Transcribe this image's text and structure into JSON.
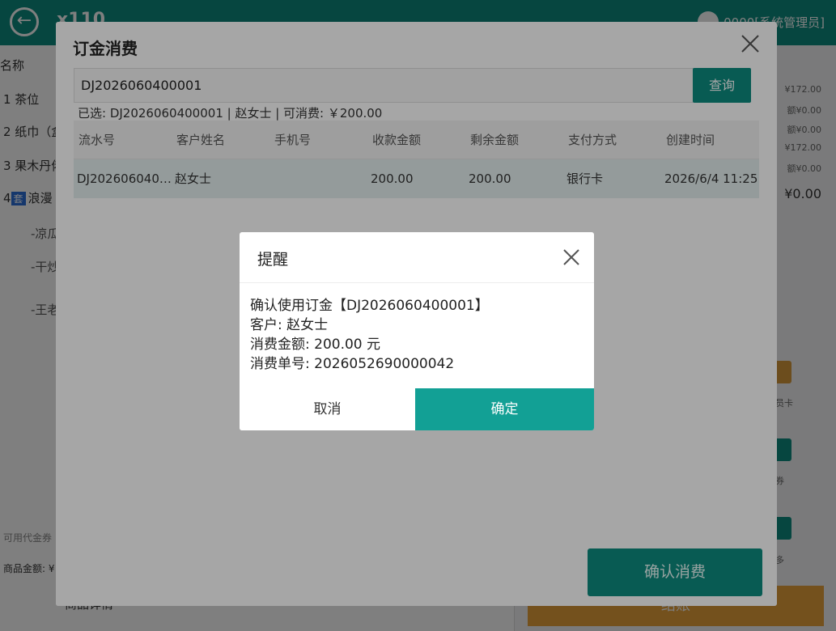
{
  "app": {
    "table_no": "x110",
    "user": "0000[系统管理员]"
  },
  "left_panel": {
    "header": "名称",
    "items": [
      {
        "label": "1 茶位"
      },
      {
        "label": "2 纸巾（盒"
      },
      {
        "label": "3 果木丹佬"
      },
      {
        "label": "浪漫",
        "prefix": "4",
        "tag": "套"
      }
    ],
    "sub_items": [
      "-凉瓜",
      "-干炒",
      "-王老"
    ],
    "footer_label": "可用代金券",
    "amount_label": "商品金额: ¥",
    "detail_button": "商品详情"
  },
  "right_panel": {
    "lines": [
      "¥172.00",
      "额¥0.00",
      "额¥0.00",
      "¥172.00",
      "额¥0.00"
    ],
    "total": "¥0.00",
    "labels": [
      "员卡",
      "券",
      "多"
    ],
    "settle_button": "结账"
  },
  "dialog": {
    "title": "订金消费",
    "search_value": "DJ2026060400001",
    "search_button": "查询",
    "selected_info": "已选: DJ2026060400001 | 赵女士 | 可消费: ￥200.00",
    "columns": [
      "流水号",
      "客户姓名",
      "手机号",
      "收款金额",
      "剩余金额",
      "支付方式",
      "创建时间"
    ],
    "rows": [
      {
        "serial": "DJ2026060400001",
        "customer": "赵女士",
        "phone": "",
        "received": "200.00",
        "remaining": "200.00",
        "payment": "银行卡",
        "created": "2026/6/4 11:25"
      }
    ],
    "confirm_button": "确认消费"
  },
  "alert": {
    "title": "提醒",
    "line1": "确认使用订金【DJ2026060400001】",
    "line2": "客户: 赵女士",
    "line3": "消费金额: 200.00 元",
    "line4": "消费单号: 2026052690000042",
    "cancel": "取消",
    "ok": "确定"
  },
  "colors": {
    "primary": "#0d8c80",
    "ok_button": "#12a095",
    "settle": "#e8a23a"
  }
}
